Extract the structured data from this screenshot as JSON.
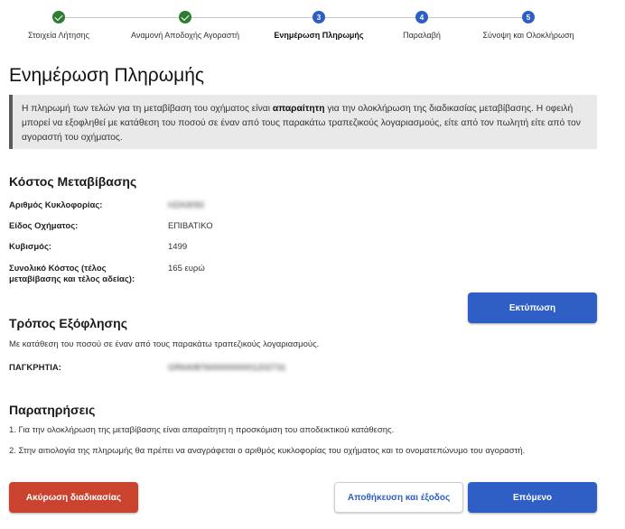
{
  "stepper": {
    "steps": [
      {
        "number": "1",
        "label": "Στοιχεία Λήτησης",
        "state": "done"
      },
      {
        "number": "2",
        "label": "Αναμονή Αποδοχής Αγοραστή",
        "state": "done"
      },
      {
        "number": "3",
        "label": "Ενημέρωση Πληρωμής",
        "state": "active"
      },
      {
        "number": "4",
        "label": "Παραλαβή",
        "state": "pending"
      },
      {
        "number": "5",
        "label": "Σύνοψη και Ολοκλήρωση",
        "state": "pending"
      }
    ]
  },
  "page": {
    "title": "Ενημέρωση Πληρωμής"
  },
  "notice": {
    "before": "Η πληρωμή των τελών για τη μεταβίβαση του οχήματος είναι ",
    "bold": "απαραίτητη",
    "after": " για την ολοκλήρωση της διαδικασίας μεταβίβασης. Η οφειλή μπορεί να εξοφληθεί με κατάθεση του ποσού σε έναν από τους παρακάτω τραπεζικούς λογαριασμούς, είτε από τον πωλητή είτε από τον αγοραστή του οχήματος."
  },
  "cost": {
    "title": "Κόστος Μεταβίβασης",
    "plate_label": "Αριθμός Κυκλοφορίας:",
    "plate_value": "ΗΖΑ3092",
    "type_label": "Είδος Οχήματος:",
    "type_value": "ΕΠΙΒΑΤΙΚΟ",
    "cc_label": "Κυβισμός:",
    "cc_value": "1499",
    "total_label_line1": "Συνολικό Κόστος (τέλος",
    "total_label_line2": "μεταβίβασης και τέλος αδείας):",
    "total_value": "165 ευρώ",
    "print_button": "Εκτύπωση"
  },
  "payment": {
    "title": "Τρόπος Εξόφλησης",
    "description": "Με κατάθεση του ποσού σε έναν από τους παρακάτω τραπεζικούς λογαριασμούς.",
    "bank_label": "ΠΑΓΚΡΗΤΙΑ:",
    "bank_value": "GR6408760000000001202731"
  },
  "remarks": {
    "title": "Παρατηρήσεις",
    "item1": "1. Για την ολοκλήρωση της μεταβίβασης είναι απαραίτητη η προσκόμιση του αποδεικτικού κατάθεσης.",
    "item2": "2. Στην αιτιολογία της πληρωμής θα πρέπει να αναγράφεται ο αριθμός κυκλοφορίας του οχήματος και το ονοματεπώνυμο του αγοραστή."
  },
  "actions": {
    "cancel": "Ακύρωση διαδικασίας",
    "save_exit": "Αποθήκευση και έξοδος",
    "next": "Επόμενο"
  },
  "colors": {
    "primary": "#2f5ec4",
    "danger": "#c9432f",
    "done": "#2e7d32"
  }
}
